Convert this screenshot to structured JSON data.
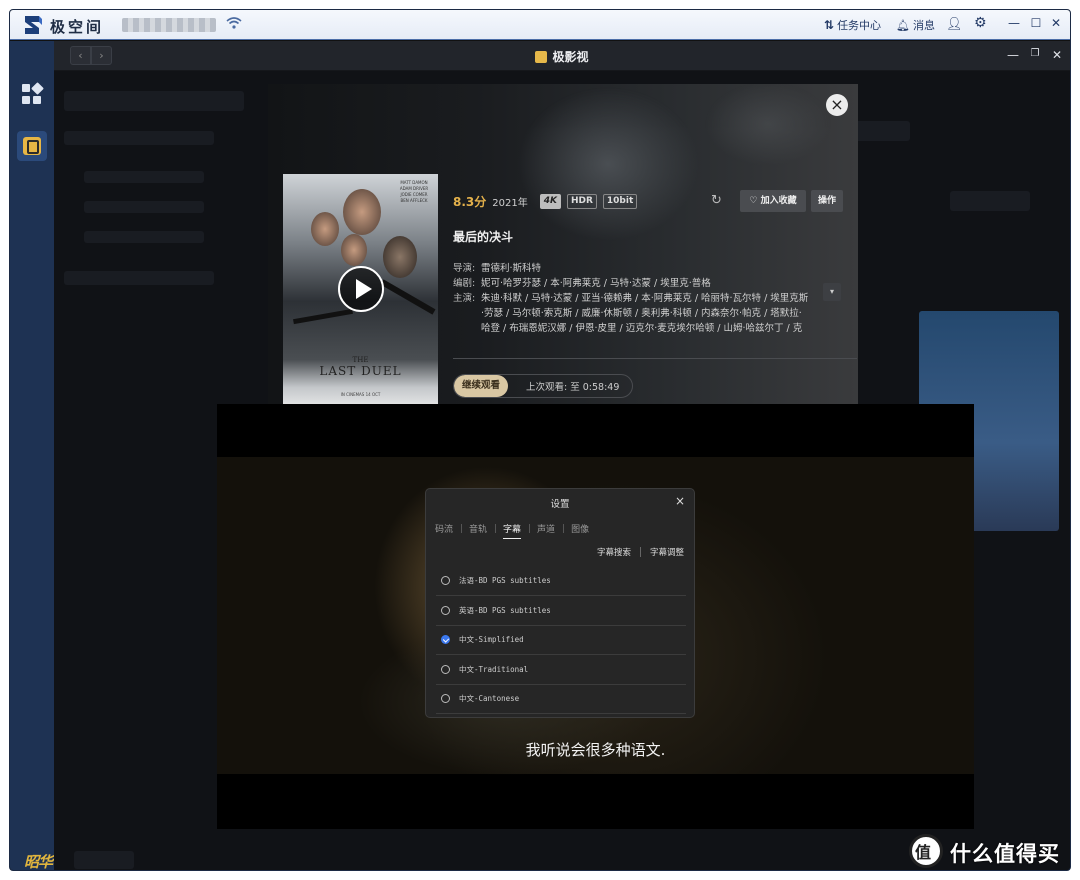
{
  "topbar": {
    "brand": "极空间",
    "tasks_label": "任务中心",
    "messages_label": "消息",
    "icons": [
      "logo-icon",
      "wifi-icon",
      "transfer-icon",
      "bell-icon",
      "user-icon",
      "gear-icon",
      "minimize-icon",
      "maximize-icon",
      "close-icon"
    ]
  },
  "app": {
    "title": "极影视",
    "back_label": "‹",
    "forward_label": "›"
  },
  "detail": {
    "score": "8.3分",
    "year": "2021年",
    "badges": [
      "4K",
      "HDR",
      "10bit"
    ],
    "favorite_label": "加入收藏",
    "operate_label": "操作",
    "title": "最后的决斗",
    "director_key": "导演:",
    "director": "雷德利·斯科特",
    "writer_key": "编剧:",
    "writers": "妮可·哈罗芬瑟 / 本·阿弗莱克 / 马特·达蒙 / 埃里克·普格",
    "cast_key": "主演:",
    "cast": "朱迪·科默 / 马特·达蒙 / 亚当·德赖弗 / 本·阿弗莱克 / 哈丽特·瓦尔特 / 埃里克斯·劳瑟 / 马尔顿·索克斯 / 威廉·休斯顿 / 奥利弗·科顿 / 内森奈尔·帕克 / 塔默拉·哈登 / 布瑞恩妮汉娜 / 伊恩·皮里 / 迈克尔·麦克埃尔哈顿 / 山姆·哈兹尔丁 / 克里",
    "resume_label": "继续观看",
    "last_watch": "上次观看: 至 0:58:49",
    "poster": {
      "title_small": "THE",
      "title": "LAST DUEL",
      "tagline": "IN CINEMAS 14 OCT",
      "credits": "MATT DAMON ADAM DRIVER JODIE COMER BEN AFFLECK"
    }
  },
  "player": {
    "subtitle": "我听说会很多种语文.",
    "settings": {
      "title": "设置",
      "close": "×",
      "tabs": [
        "码流",
        "音轨",
        "字幕",
        "声道",
        "图像"
      ],
      "active_tab": "字幕",
      "search_label": "字幕搜索",
      "adjust_label": "字幕调整",
      "subtitles": [
        {
          "label": "法语-BD PGS subtitles",
          "selected": false
        },
        {
          "label": "英语-BD PGS subtitles",
          "selected": false
        },
        {
          "label": "中文-Simplified",
          "selected": true
        },
        {
          "label": "中文-Traditional",
          "selected": false
        },
        {
          "label": "中文-Cantonese",
          "selected": false
        }
      ]
    }
  },
  "watermark": {
    "left": "昭华阁",
    "right": "什么值得买",
    "right_logo": "值"
  },
  "colors": {
    "accent_gold": "#e4b14b",
    "sidebar_blue": "#1e3253",
    "selected_blue": "#3b78ee"
  }
}
